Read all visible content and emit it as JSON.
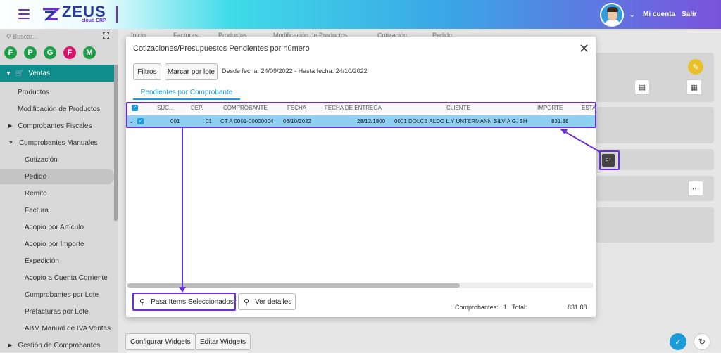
{
  "app": {
    "title": "ZEUS",
    "subtitle": "cloud ERP"
  },
  "topnav": {
    "mi_cuenta": "Mi cuenta",
    "salir": "Salir"
  },
  "sidebar": {
    "search_placeholder": "Buscar...",
    "favorites": [
      "F",
      "P",
      "G",
      "F",
      "M"
    ],
    "favorite_colors": [
      "#1f9e4a",
      "#1f9e4a",
      "#1f9e4a",
      "#d8136b",
      "#1f9e4a"
    ],
    "section": "Ventas",
    "items": [
      {
        "label": "Productos"
      },
      {
        "label": "Modificación de Productos"
      },
      {
        "label": "Comprobantes Fiscales"
      },
      {
        "label": "Comprobantes Manuales"
      },
      {
        "label": "Cotización"
      },
      {
        "label": "Pedido"
      },
      {
        "label": "Remito"
      },
      {
        "label": "Factura"
      },
      {
        "label": "Acopio por Artículo"
      },
      {
        "label": "Acopio por Importe"
      },
      {
        "label": "Expedición"
      },
      {
        "label": "Acopio a Cuenta Corriente"
      },
      {
        "label": "Comprobantes por Lote"
      },
      {
        "label": "Prefacturas por Lote"
      },
      {
        "label": "ABM Manual de IVA Ventas"
      },
      {
        "label": "Gestión de Comprobantes"
      }
    ]
  },
  "bg_tabs": [
    "Inicio",
    "Facturas",
    "Productos",
    "Modificación de Productos",
    "Cotización",
    "Pedido"
  ],
  "modal": {
    "title": "Cotizaciones/Presupuestos Pendientes por número",
    "filtros": "Filtros",
    "marcar": "Marcar por lote",
    "dates": "Desde fecha: 24/09/2022 - Hasta fecha: 24/10/2022",
    "tab": "Pendientes por Comprobante",
    "columns": [
      "SUC...",
      "DEP.",
      "COMPROBANTE",
      "FECHA",
      "FECHA DE ENTREGA",
      "CLIENTE",
      "IMPORTE",
      "ESTA"
    ],
    "row": {
      "suc": "001",
      "dep": "01",
      "comprobante": "CT A 0001-00000004",
      "fecha": "06/10/2022",
      "entrega": "28/12/1800",
      "cliente": "0001 DOLCE ALDO L.Y UNTERMANN SILVIA G. SH",
      "importe": "831.88"
    },
    "pasa": "Pasa Items Seleccionados",
    "ver": "Ver detalles",
    "comprobantes_label": "Comprobantes:",
    "comprobantes_count": "1",
    "total_label": "Total:",
    "total_value": "831.88"
  },
  "bottom": {
    "configurar": "Configurar Widgets",
    "editar": "Editar Widgets"
  },
  "ct_badge": "CT"
}
